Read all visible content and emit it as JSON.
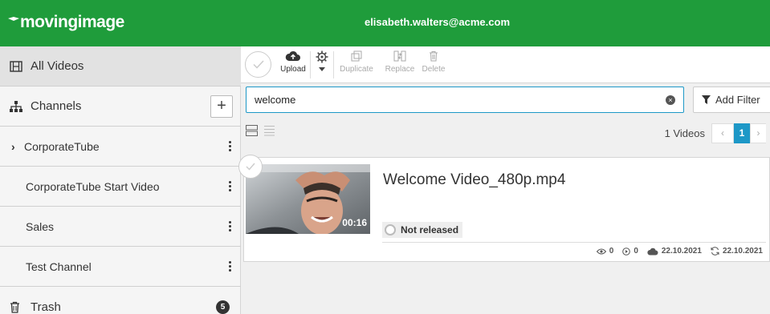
{
  "header": {
    "logo_text": "movingimage",
    "user_email": "elisabeth.walters@acme.com",
    "brand_color": "#1f9c3b"
  },
  "sidebar": {
    "all_videos": "All Videos",
    "channels_label": "Channels",
    "channels": [
      {
        "label": "CorporateTube",
        "expandable": true
      },
      {
        "label": "CorporateTube Start Video",
        "expandable": false
      },
      {
        "label": "Sales",
        "expandable": false
      },
      {
        "label": "Test Channel",
        "expandable": false
      }
    ],
    "trash_label": "Trash",
    "trash_count": "5"
  },
  "toolbar": {
    "upload": "Upload",
    "duplicate": "Duplicate",
    "replace": "Replace",
    "delete": "Delete"
  },
  "search": {
    "value": "welcome",
    "add_filter": "Add Filter"
  },
  "results": {
    "count_label": "1 Videos",
    "current_page": "1"
  },
  "video": {
    "title": "Welcome Video_480p.mp4",
    "duration": "00:16",
    "status": "Not released",
    "views": "0",
    "plays": "0",
    "uploaded": "22.10.2021",
    "modified": "22.10.2021"
  }
}
